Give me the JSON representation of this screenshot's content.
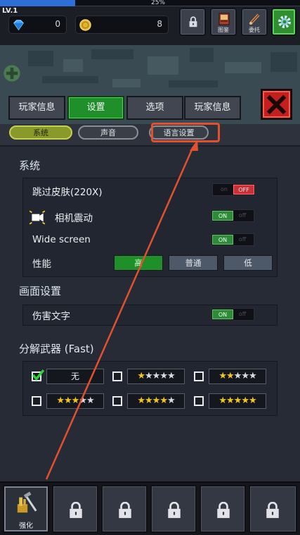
{
  "hud": {
    "level": "LV.1",
    "xp_percent_text": "25%",
    "xp_fraction": 0.25,
    "gems": "0",
    "coins": "8",
    "book_label": "图鉴",
    "task_label": "委托"
  },
  "tabs": [
    "玩家信息",
    "设置",
    "选项",
    "玩家信息"
  ],
  "active_tab": "设置",
  "subtabs": {
    "system": "系统",
    "sound": "声音",
    "language": "语言设置"
  },
  "system": {
    "title": "系统",
    "rows": {
      "skip_skin": {
        "label": "跳过皮肤(220X)",
        "on": "on",
        "off": "OFF"
      },
      "camera_shake": {
        "label": "相机震动",
        "on": "ON",
        "off": "off"
      },
      "wide_screen": {
        "label": "Wide screen",
        "on": "ON",
        "off": "off"
      },
      "performance": {
        "label": "性能",
        "options": [
          "高",
          "普通",
          "低"
        ]
      }
    }
  },
  "display": {
    "title": "画面设置",
    "damage_text": {
      "label": "伤害文字",
      "on": "ON",
      "off": "off"
    }
  },
  "dismantle": {
    "title": "分解武器 (Fast)",
    "none_label": "无",
    "star_rows": [
      1,
      2,
      3,
      4,
      5
    ],
    "checked": [
      "无"
    ]
  },
  "bottom": {
    "upgrade_label": "强化"
  },
  "colors": {
    "active_green": "#1f8f2a",
    "highlight": "#e2512f",
    "close_red": "#c21f1f",
    "star_gold": "#f3c61f"
  }
}
